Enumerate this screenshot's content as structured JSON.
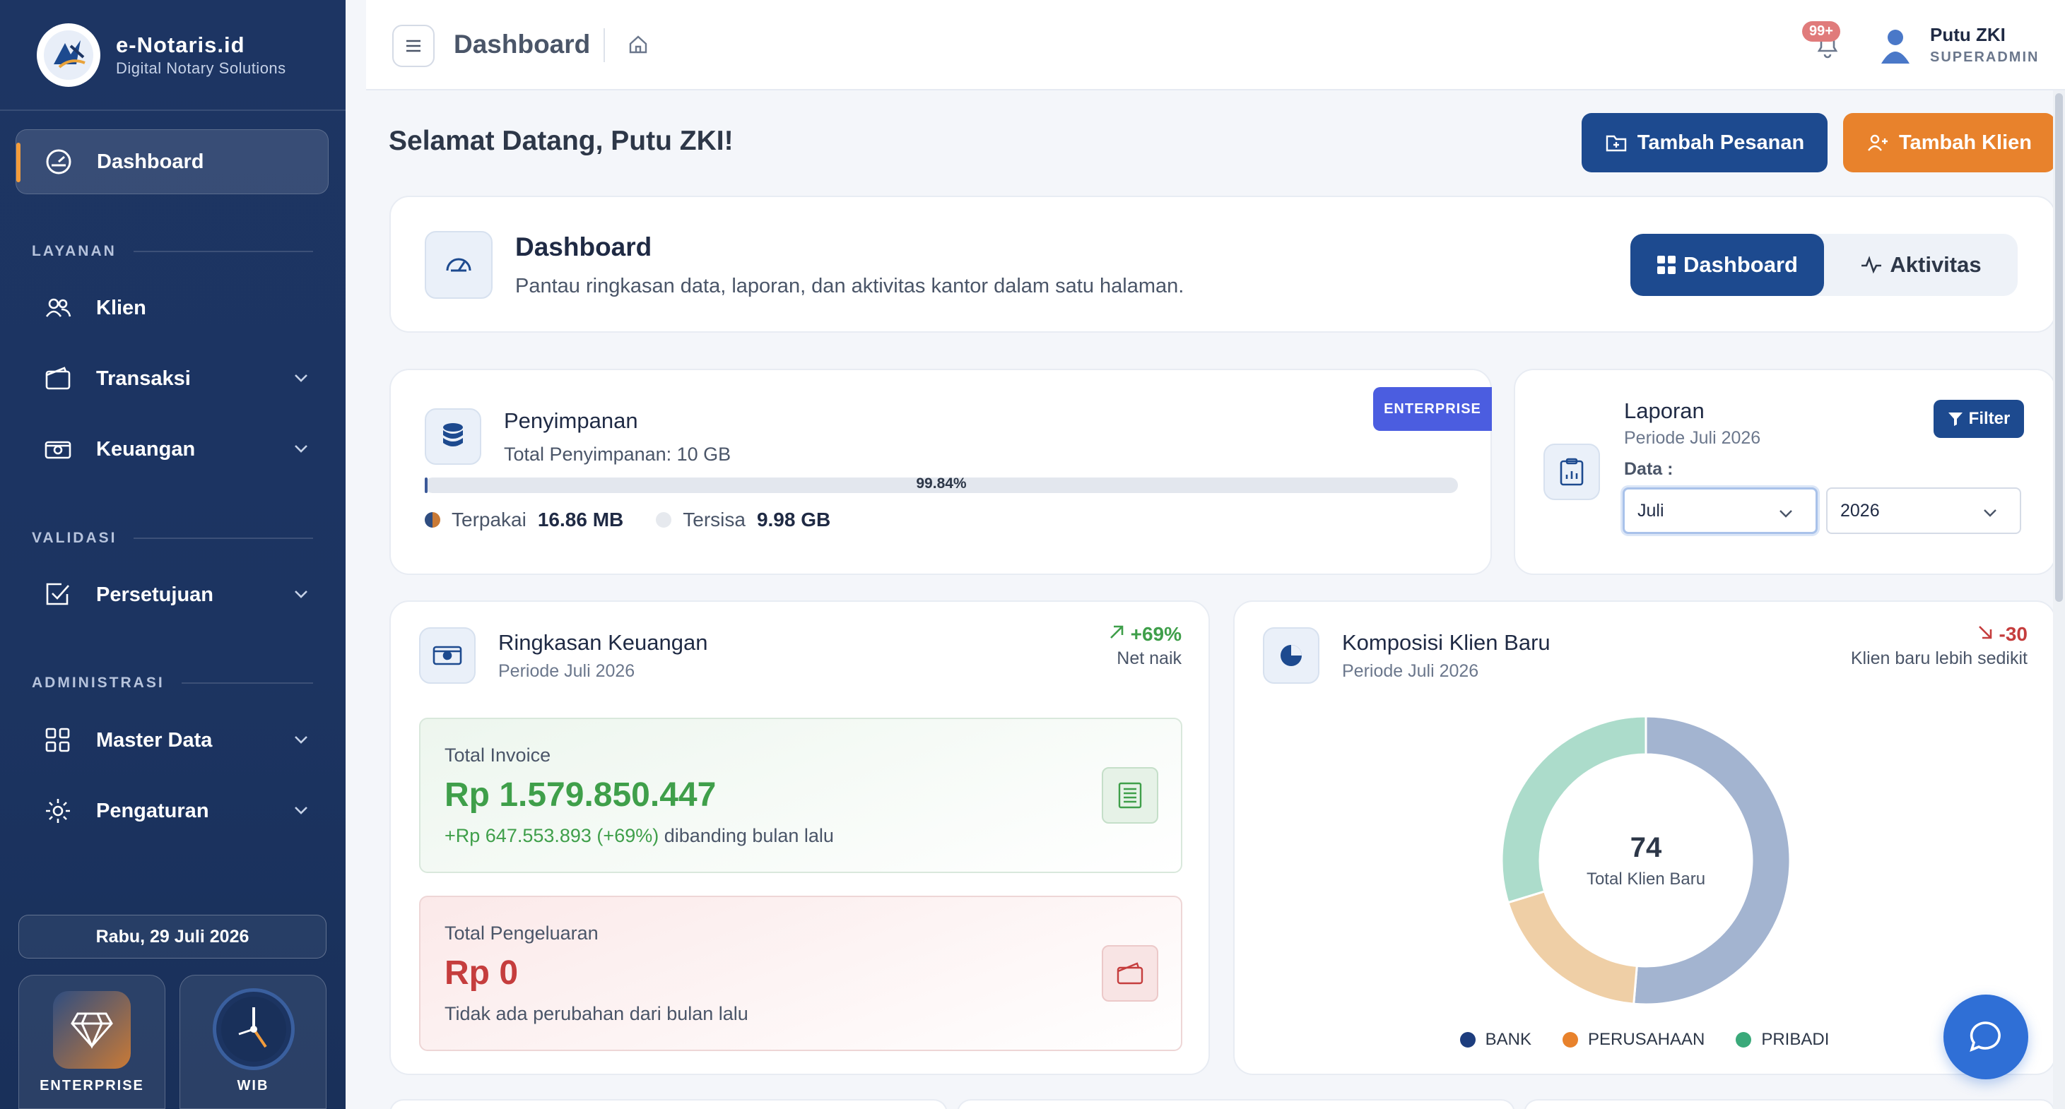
{
  "brand": {
    "name": "e-Notaris.id",
    "subtitle": "Digital Notary Solutions"
  },
  "sidebar": {
    "active": {
      "label": "Dashboard",
      "icon": "gauge-icon"
    },
    "sections": [
      {
        "title": "LAYANAN",
        "items": [
          {
            "label": "Klien",
            "icon": "users-icon",
            "has_chevron": false
          },
          {
            "label": "Transaksi",
            "icon": "wallet-icon",
            "has_chevron": true
          },
          {
            "label": "Keuangan",
            "icon": "money-icon",
            "has_chevron": true
          }
        ]
      },
      {
        "title": "VALIDASI",
        "items": [
          {
            "label": "Persetujuan",
            "icon": "check-square-icon",
            "has_chevron": true
          }
        ]
      },
      {
        "title": "ADMINISTRASI",
        "items": [
          {
            "label": "Master Data",
            "icon": "grid-icon",
            "has_chevron": true
          },
          {
            "label": "Pengaturan",
            "icon": "gear-icon",
            "has_chevron": true
          }
        ]
      }
    ],
    "date": "Rabu, 29 Juli 2026",
    "plan_label": "ENTERPRISE",
    "timezone_label": "WIB"
  },
  "topbar": {
    "title": "Dashboard",
    "notifications": "99+",
    "user_name": "Putu ZKI",
    "user_role": "SUPERADMIN"
  },
  "main": {
    "welcome": "Selamat Datang, Putu ZKI!",
    "btn_pesanan": "Tambah Pesanan",
    "btn_klien": "Tambah Klien",
    "header": {
      "title": "Dashboard",
      "subtitle": "Pantau ringkasan data, laporan, dan aktivitas kantor dalam satu halaman.",
      "tab_dashboard": "Dashboard",
      "tab_aktivitas": "Aktivitas"
    },
    "storage": {
      "title": "Penyimpanan",
      "subtitle": "Total Penyimpanan: 10 GB",
      "badge": "ENTERPRISE",
      "percent_label": "99.84%",
      "used_fraction": 0.0016,
      "used_label": "Terpakai",
      "used_value": "16.86 MB",
      "free_label": "Tersisa",
      "free_value": "9.98 GB"
    },
    "report": {
      "title": "Laporan",
      "period": "Periode Juli 2026",
      "data_label": "Data :",
      "filter": "Filter",
      "month": "Juli",
      "year": "2026"
    },
    "finance": {
      "title": "Ringkasan Keuangan",
      "period": "Periode Juli 2026",
      "trend_value": "+69%",
      "trend_label": "Net naik",
      "invoice_label": "Total Invoice",
      "invoice_value": "Rp 1.579.850.447",
      "invoice_delta": "+Rp 647.553.893 (+69%)",
      "invoice_delta_suffix": " dibanding bulan lalu",
      "expense_label": "Total Pengeluaran",
      "expense_value": "Rp 0",
      "expense_note": "Tidak ada perubahan dari bulan lalu"
    },
    "composition": {
      "title": "Komposisi Klien Baru",
      "period": "Periode Juli 2026",
      "trend_value": "-30",
      "trend_label": "Klien baru lebih sedikit",
      "total": "74",
      "total_label": "Total Klien Baru"
    }
  },
  "chart_data": {
    "type": "pie",
    "categories": [
      "BANK",
      "PERUSAHAAN",
      "PRIBADI"
    ],
    "values": [
      38,
      14,
      22
    ],
    "colors": [
      "#a3b4d0",
      "#efcfa6",
      "#acdccb"
    ],
    "legend_colors": [
      "#1d3d7e",
      "#e8822c",
      "#3aa97a"
    ],
    "legend": "bottom"
  },
  "colors": {
    "primary": "#1d4a8f",
    "accent": "#e8822c",
    "sidebar": "#1d3563",
    "positive": "#3f9f4a",
    "negative": "#c53d3d"
  }
}
